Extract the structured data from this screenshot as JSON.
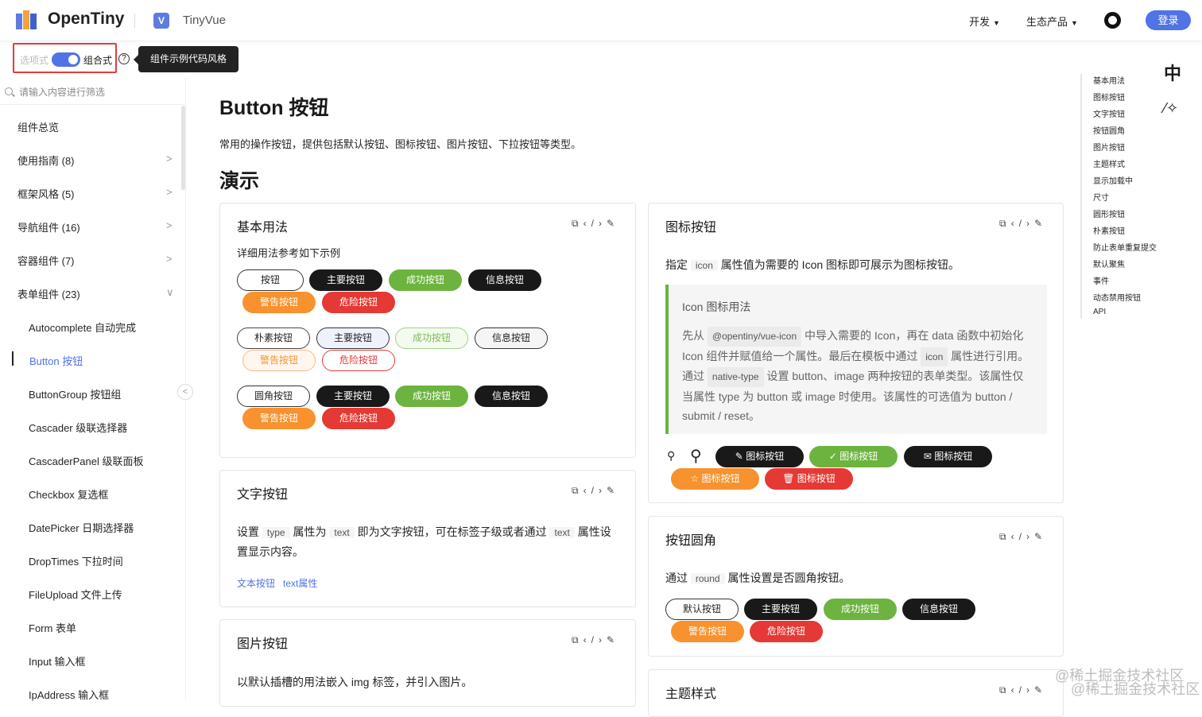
{
  "header": {
    "brand": "OpenTiny",
    "product": "TinyVue",
    "nav": [
      {
        "label": "开发"
      },
      {
        "label": "生态产品"
      }
    ],
    "login": "登录",
    "icons": [
      "opentiny-logo-icon",
      "tinyvue-logo-icon",
      "github-icon"
    ]
  },
  "api_switch": {
    "options_label": "选项式",
    "composition_label": "组合式",
    "help": "?",
    "tooltip": "组件示例代码风格"
  },
  "sidebar": {
    "search_placeholder": "请输入内容进行筛选",
    "items": [
      {
        "label": "组件总览",
        "arrow": ""
      },
      {
        "label": "使用指南 (8)",
        "arrow": ">"
      },
      {
        "label": "框架风格 (5)",
        "arrow": ">"
      },
      {
        "label": "导航组件 (16)",
        "arrow": ">"
      },
      {
        "label": "容器组件 (7)",
        "arrow": ">"
      },
      {
        "label": "表单组件 (23)",
        "arrow": "∨"
      },
      {
        "label": "Autocomplete 自动完成"
      },
      {
        "label": "Button 按钮",
        "active": true
      },
      {
        "label": "ButtonGroup 按钮组"
      },
      {
        "label": "Cascader 级联选择器"
      },
      {
        "label": "CascaderPanel 级联面板"
      },
      {
        "label": "Checkbox 复选框"
      },
      {
        "label": "DatePicker 日期选择器"
      },
      {
        "label": "DropTimes 下拉时间"
      },
      {
        "label": "FileUpload 文件上传"
      },
      {
        "label": "Form 表单"
      },
      {
        "label": "Input 输入框"
      },
      {
        "label": "IpAddress 输入框"
      }
    ],
    "collapse": "<"
  },
  "main": {
    "title": "Button 按钮",
    "description": "常用的操作按钮，提供包括默认按钮、图标按钮、图片按钮、下拉按钮等类型。",
    "demo_heading": "演示",
    "card_basic": {
      "title": "基本用法",
      "desc": "详细用法参考如下示例",
      "row1": [
        "按钮",
        "主要按钮",
        "成功按钮",
        "信息按钮",
        "警告按钮",
        "危险按钮"
      ],
      "row2": [
        "朴素按钮",
        "主要按钮",
        "成功按钮",
        "信息按钮",
        "警告按钮",
        "危险按钮"
      ],
      "row3": [
        "圆角按钮",
        "主要按钮",
        "成功按钮",
        "信息按钮",
        "警告按钮",
        "危险按钮"
      ]
    },
    "card_text": {
      "title": "文字按钮",
      "t1": "设置",
      "c1": "type",
      "t2": "属性为",
      "c2": "text",
      "t3": "即为文字按钮，可在标签子级或者通过",
      "c3": "text",
      "t4": "属性设",
      "t5": "置显示内容。",
      "links": [
        "文本按钮",
        "text属性"
      ]
    },
    "card_image": {
      "title": "图片按钮",
      "desc": "以默认插槽的用法嵌入 img 标签，并引入图片。"
    },
    "card_icon": {
      "title": "图标按钮",
      "t1": "指定",
      "c1": "icon",
      "t2": "属性值为需要的 Icon 图标即可展示为图标按钮。",
      "note_title": "Icon 图标用法",
      "n1": "先从",
      "nc1": "@opentiny/vue-icon",
      "n2": "中导入需要的 Icon，再在 data 函数中初始化",
      "n3": "Icon 组件并赋值给一个属性。最后在模板中通过",
      "nc2": "icon",
      "n4": "属性进行引用。",
      "n5": "通过",
      "nc3": "native-type",
      "n6": "设置 button、image 两种按钮的表单类型。该属性仅",
      "n7": "当属性 type 为 button 或 image 时使用。该属性的可选值为 button /",
      "n8": "submit / reset。",
      "buttons": [
        "图标按钮",
        "图标按钮",
        "图标按钮",
        "图标按钮",
        "图标按钮"
      ]
    },
    "card_round": {
      "title": "按钮圆角",
      "t1": "通过",
      "c1": "round",
      "t2": "属性设置是否圆角按钮。",
      "buttons": [
        "默认按钮",
        "主要按钮",
        "成功按钮",
        "信息按钮",
        "警告按钮",
        "危险按钮"
      ]
    },
    "card_theme": {
      "title": "主题样式"
    }
  },
  "toc": {
    "items": [
      "基本用法",
      "图标按钮",
      "文字按钮",
      "按钮圆角",
      "图片按钮",
      "主题样式",
      "显示加载中",
      "尺寸",
      "圆形按钮",
      "朴素按钮",
      "防止表单重复提交",
      "默认聚焦",
      "事件",
      "动态禁用按钮",
      "API"
    ],
    "lang": "中"
  },
  "watermark": "@稀土掘金技术社区",
  "colors": {
    "brand": "#5073e5",
    "success": "#6db33f",
    "warning": "#f7922e",
    "danger": "#e53935",
    "info": "#191919"
  }
}
